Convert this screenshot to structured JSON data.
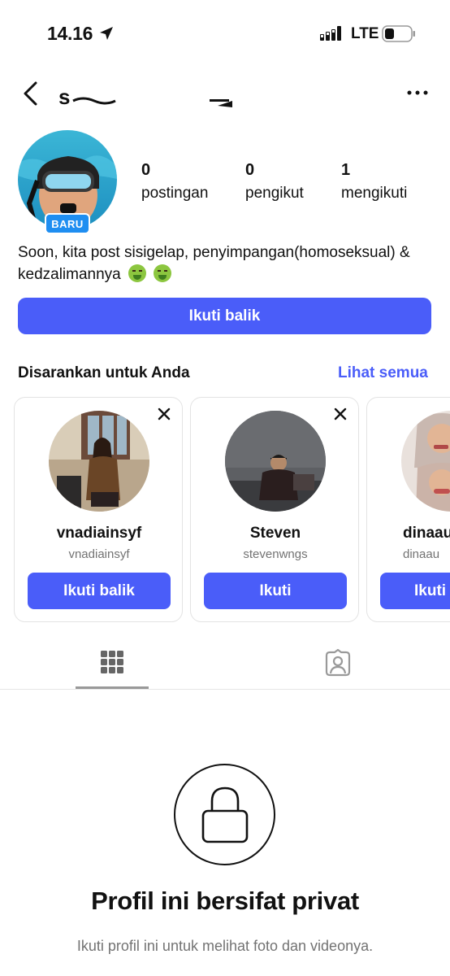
{
  "status_bar": {
    "time": "14.16",
    "network": "LTE"
  },
  "header": {
    "username_partial": "s"
  },
  "profile": {
    "badge": "BARU",
    "stats": [
      {
        "value": "0",
        "label": "postingan"
      },
      {
        "value": "0",
        "label": "pengikut"
      },
      {
        "value": "1",
        "label": "mengikuti"
      }
    ],
    "bio": "Soon, kita post sisigelap, penyimpangan(homoseksual) & kedzalimannya",
    "follow_back_label": "Ikuti balik"
  },
  "suggestions": {
    "title": "Disarankan untuk Anda",
    "see_all": "Lihat semua",
    "cards": [
      {
        "name": "vnadiainsyf",
        "handle": "vnadiainsyf",
        "button": "Ikuti balik"
      },
      {
        "name": "Steven",
        "handle": "stevenwngs",
        "button": "Ikuti"
      },
      {
        "name": "dinaau",
        "handle": "dinaau",
        "button": "Ikuti"
      }
    ]
  },
  "tabs": [
    {
      "icon": "grid-icon",
      "selected": true
    },
    {
      "icon": "tagged-icon",
      "selected": false
    }
  ],
  "private_notice": {
    "title": "Profil ini bersifat privat",
    "subtitle": "Ikuti profil ini untuk melihat foto dan videonya."
  },
  "colors": {
    "accent": "#4a5df9",
    "badge": "#1f8ef1",
    "muted_text": "#737373"
  }
}
